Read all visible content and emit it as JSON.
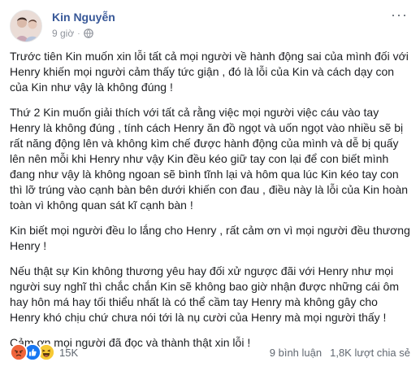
{
  "author": {
    "name": "Kin Nguyễn"
  },
  "post_meta": {
    "time": "9 giờ",
    "separator": "·",
    "privacy_icon": "globe-icon",
    "more_icon": "more-options-icon"
  },
  "paragraphs": [
    "Trước tiên Kin muốn xin lỗi tất cả mọi người về hành động sai của mình đối với Henry khiến mọi người cảm thấy tức giận , đó là lỗi của Kin và cách dạy con của Kin như vậy là không đúng !",
    "Thứ 2 Kin muốn giải thích với tất cả rằng việc mọi người việc cáu vào tay Henry là không đúng , tính cách Henry ăn đồ ngọt và uốn ngọt vào nhiều sẽ bị rất năng động lên và không kìm chế được hành động của mình và dễ bị quấy lên nên mỗi khi Henry như vậy Kin đều kéo giữ tay con lại để con biết mình đang như vậy là không ngoan sẽ bình tĩnh lại và hôm qua lúc Kin kéo tay con thì lỡ trúng vào cạnh bàn bên dưới khiến con đau , điều này là lỗi của Kin hoàn toàn vì không quan sát kĩ cạnh bàn !",
    "Kin biết mọi người đều lo lắng cho Henry , rất cảm ơn vì mọi người đều thương Henry !",
    "Nếu thật sự Kin không thương yêu hay đối xử ngược đãi với Henry như mọi người suy nghĩ thì chắc chắn Kin sẽ không bao giờ nhận được những cái ôm hay hôn má hay tối thiểu nhất là có thể cầm tay Henry mà không gây cho Henry khó chịu chứ chưa nói tới là nụ cười của Henry mà mọi người thấy !",
    "Cảm ơn mọi người đã đọc và thành thật xin lỗi !"
  ],
  "reactions": {
    "icons": [
      "angry-react-icon",
      "like-react-icon",
      "haha-react-icon"
    ],
    "count": "15K"
  },
  "stats": {
    "comments": "9 bình luận",
    "shares": "1,8K lượt chia sẻ"
  },
  "colors": {
    "author_link": "#385898",
    "meta_text": "#90949c",
    "angry": "#f0653b",
    "like": "#1877f2",
    "haha": "#f7c934"
  }
}
